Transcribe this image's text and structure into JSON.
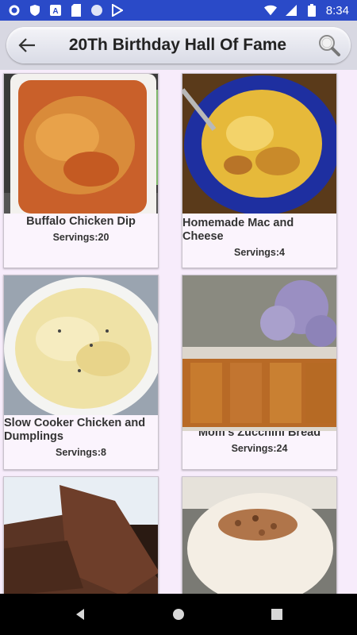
{
  "status_bar": {
    "time": "8:34"
  },
  "toolbar": {
    "title": "20Th Birthday Hall Of Fame"
  },
  "recipes": [
    {
      "title": "Buffalo Chicken Dip",
      "servings": "Servings:20"
    },
    {
      "title": "Homemade Mac and Cheese",
      "servings": "Servings:4"
    },
    {
      "title": "Slow Cooker Chicken and Dumplings",
      "servings": "Servings:8"
    },
    {
      "title": "Mom's Zucchini Bread",
      "servings": "Servings:24"
    },
    {
      "title": "",
      "servings": ""
    },
    {
      "title": "",
      "servings": ""
    }
  ],
  "colors": {
    "status_bar": "#2a4ac8",
    "background": "#f7ecfb",
    "nav_bar": "#000000"
  }
}
